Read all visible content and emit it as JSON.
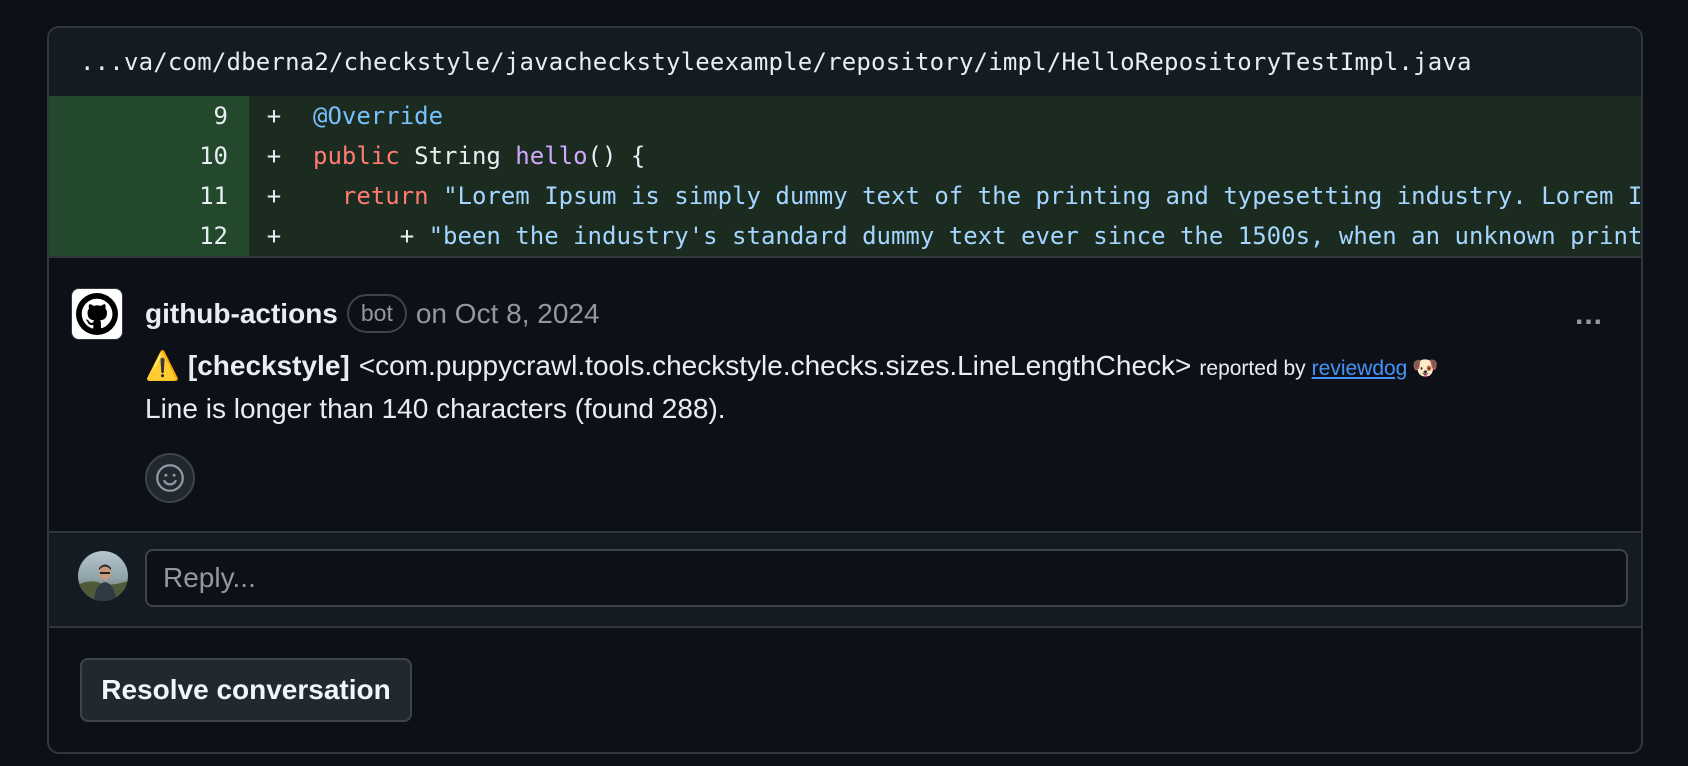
{
  "file": {
    "path": "...va/com/dberna2/checkstyle/javacheckstyleexample/repository/impl/HelloRepositoryTestImpl.java"
  },
  "diff": {
    "rows": [
      {
        "line": "9",
        "sign": "+",
        "indent": "",
        "tokens": [
          {
            "t": "@Override",
            "c": "ann"
          }
        ]
      },
      {
        "line": "10",
        "sign": "+",
        "indent": "",
        "tokens": [
          {
            "t": "public",
            "c": "kw"
          },
          {
            "t": " String ",
            "c": ""
          },
          {
            "t": "hello",
            "c": "fn"
          },
          {
            "t": "() {",
            "c": ""
          }
        ]
      },
      {
        "line": "11",
        "sign": "+",
        "indent": "  ",
        "tokens": [
          {
            "t": "return",
            "c": "kw"
          },
          {
            "t": " ",
            "c": ""
          },
          {
            "t": "\"Lorem Ipsum is simply dummy text of the printing and typesetting industry. Lorem I",
            "c": "str"
          }
        ]
      },
      {
        "line": "12",
        "sign": "+",
        "indent": "      ",
        "tokens": [
          {
            "t": "+ ",
            "c": ""
          },
          {
            "t": "\"been the industry's standard dummy text ever since the 1500s, when an unknown print",
            "c": "str"
          }
        ]
      }
    ]
  },
  "comment": {
    "author": "github-actions",
    "badge": "bot",
    "date": "on Oct 8, 2024",
    "more_label": "...",
    "warning_emoji": "⚠️",
    "tag": "[checkstyle]",
    "check": "<com.puppycrawl.tools.checkstyle.checks.sizes.LineLengthCheck>",
    "reported_by": "reported by",
    "reporter_link": "reviewdog",
    "reporter_emoji": "🐶",
    "message": "Line is longer than 140 characters (found 288).",
    "icons": {
      "avatar": "github-mark-icon",
      "reaction": "smiley-icon"
    }
  },
  "reply": {
    "placeholder": "Reply..."
  },
  "actions": {
    "resolve_label": "Resolve conversation"
  }
}
